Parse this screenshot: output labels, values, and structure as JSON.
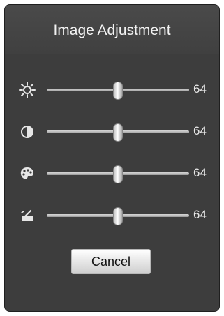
{
  "dialog": {
    "title": "Image Adjustment"
  },
  "sliders": [
    {
      "icon": "brightness-icon",
      "level_percent": 50,
      "value": "64"
    },
    {
      "icon": "contrast-icon",
      "level_percent": 50,
      "value": "64"
    },
    {
      "icon": "saturation-icon",
      "level_percent": 50,
      "value": "64"
    },
    {
      "icon": "hue-icon",
      "level_percent": 50,
      "value": "64"
    }
  ],
  "buttons": {
    "cancel_label": "Cancel"
  },
  "colors": {
    "panel_bg": "#3d3d3d",
    "text": "#e8e8e8",
    "track": "#bdbdbd"
  }
}
